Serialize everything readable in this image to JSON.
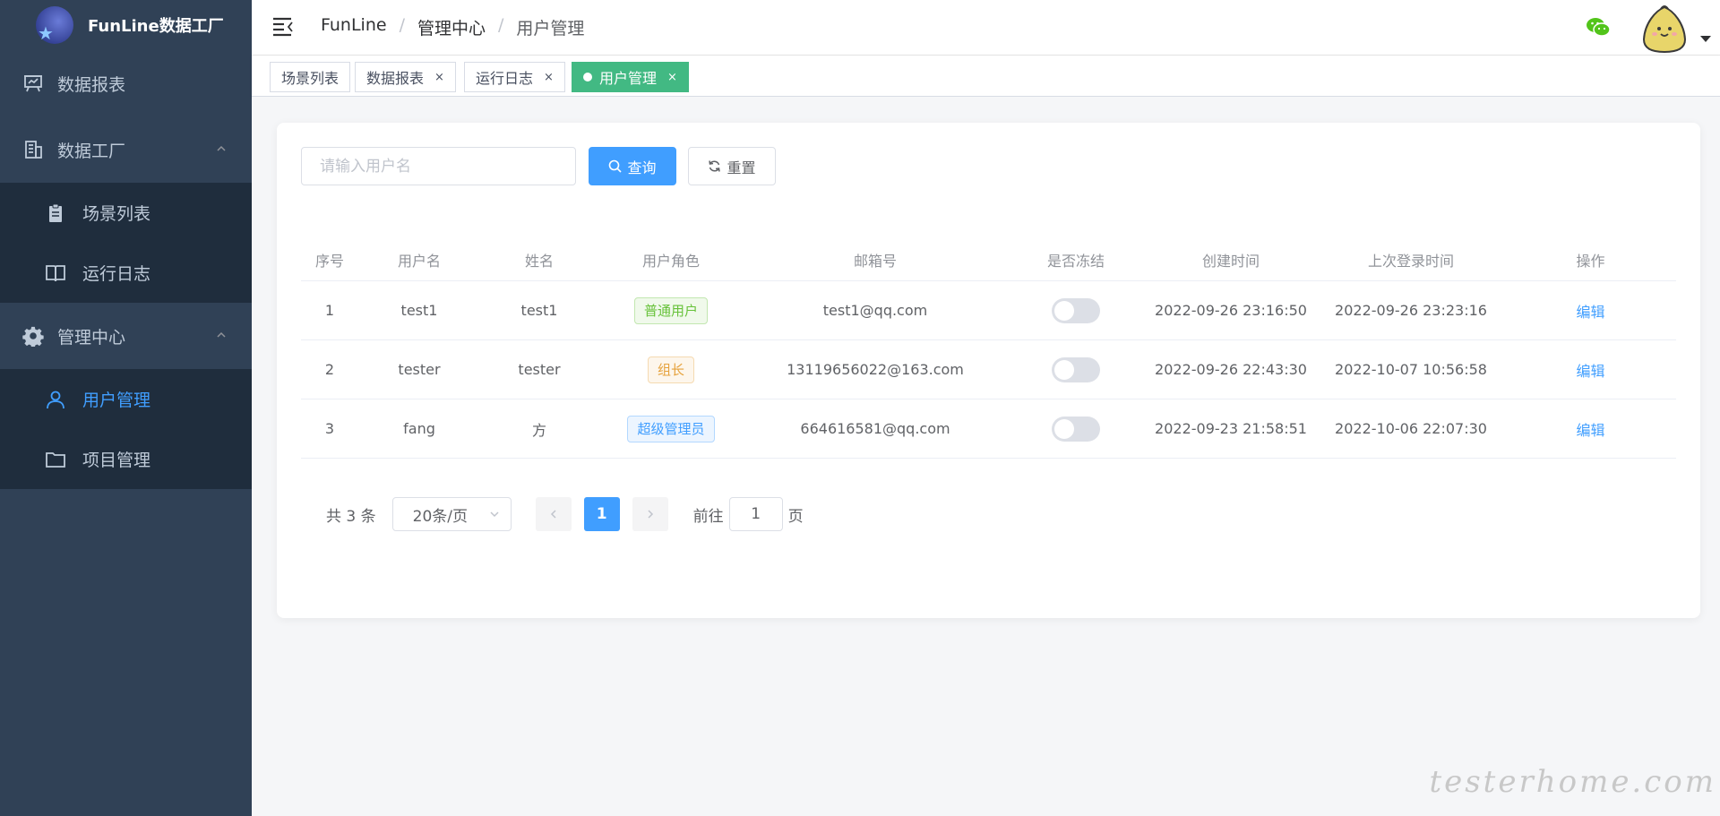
{
  "app": {
    "title": "FunLine数据工厂"
  },
  "sidebar": {
    "items": [
      {
        "label": "数据报表",
        "icon": "presentation-icon"
      },
      {
        "label": "数据工厂",
        "icon": "building-icon",
        "expanded": true,
        "children": [
          {
            "label": "场景列表",
            "icon": "clipboard-icon"
          },
          {
            "label": "运行日志",
            "icon": "book-icon"
          }
        ]
      },
      {
        "label": "管理中心",
        "icon": "gear-icon",
        "expanded": true,
        "children": [
          {
            "label": "用户管理",
            "icon": "user-icon",
            "active": true
          },
          {
            "label": "项目管理",
            "icon": "folder-icon"
          }
        ]
      }
    ]
  },
  "breadcrumb": [
    "FunLine",
    "管理中心",
    "用户管理"
  ],
  "tags": [
    {
      "label": "场景列表",
      "closable": false,
      "active": false
    },
    {
      "label": "数据报表",
      "closable": true,
      "active": false
    },
    {
      "label": "运行日志",
      "closable": true,
      "active": false
    },
    {
      "label": "用户管理",
      "closable": true,
      "active": true
    }
  ],
  "tag_close_glyph": "×",
  "search": {
    "placeholder": "请输入用户名",
    "value": ""
  },
  "buttons": {
    "query": "查询",
    "reset": "重置",
    "edit": "编辑"
  },
  "table": {
    "columns": [
      "序号",
      "用户名",
      "姓名",
      "用户角色",
      "邮箱号",
      "是否冻结",
      "创建时间",
      "上次登录时间",
      "操作"
    ],
    "rows": [
      {
        "index": "1",
        "username": "test1",
        "name": "test1",
        "role": "普通用户",
        "email": "test1@qq.com",
        "frozen": false,
        "created": "2022-09-26 23:16:50",
        "last_login": "2022-09-26 23:23:16",
        "action": "编辑"
      },
      {
        "index": "2",
        "username": "tester",
        "name": "tester",
        "role": "组长",
        "email": "13119656022@163.com",
        "frozen": false,
        "created": "2022-09-26 22:43:30",
        "last_login": "2022-10-07 10:56:58",
        "action": "编辑"
      },
      {
        "index": "3",
        "username": "fang",
        "name": "方",
        "role": "超级管理员",
        "email": "664616581@qq.com",
        "frozen": false,
        "created": "2022-09-23 21:58:51",
        "last_login": "2022-10-06 22:07:30",
        "action": "编辑"
      }
    ]
  },
  "role_colors": {
    "普通用户": {
      "text": "#67c23a",
      "border": "#c2e7b0",
      "bg": "#f0f9eb"
    },
    "组长": {
      "text": "#e6a23c",
      "border": "#f5dab1",
      "bg": "#fdf6ec"
    },
    "超级管理员": {
      "text": "#409eff",
      "border": "#b3d8ff",
      "bg": "#ecf5ff"
    }
  },
  "pagination": {
    "total_text": "共 3 条",
    "page_size": "20条/页",
    "current_page": "1",
    "goto_label": "前往",
    "goto_value": "1",
    "page_suffix": "页"
  },
  "watermark": "testerhome.com",
  "colors": {
    "primary": "#409eff",
    "sidebar_bg": "#304156",
    "submenu_bg": "#1f2d3d",
    "active_tag": "#42b983"
  }
}
